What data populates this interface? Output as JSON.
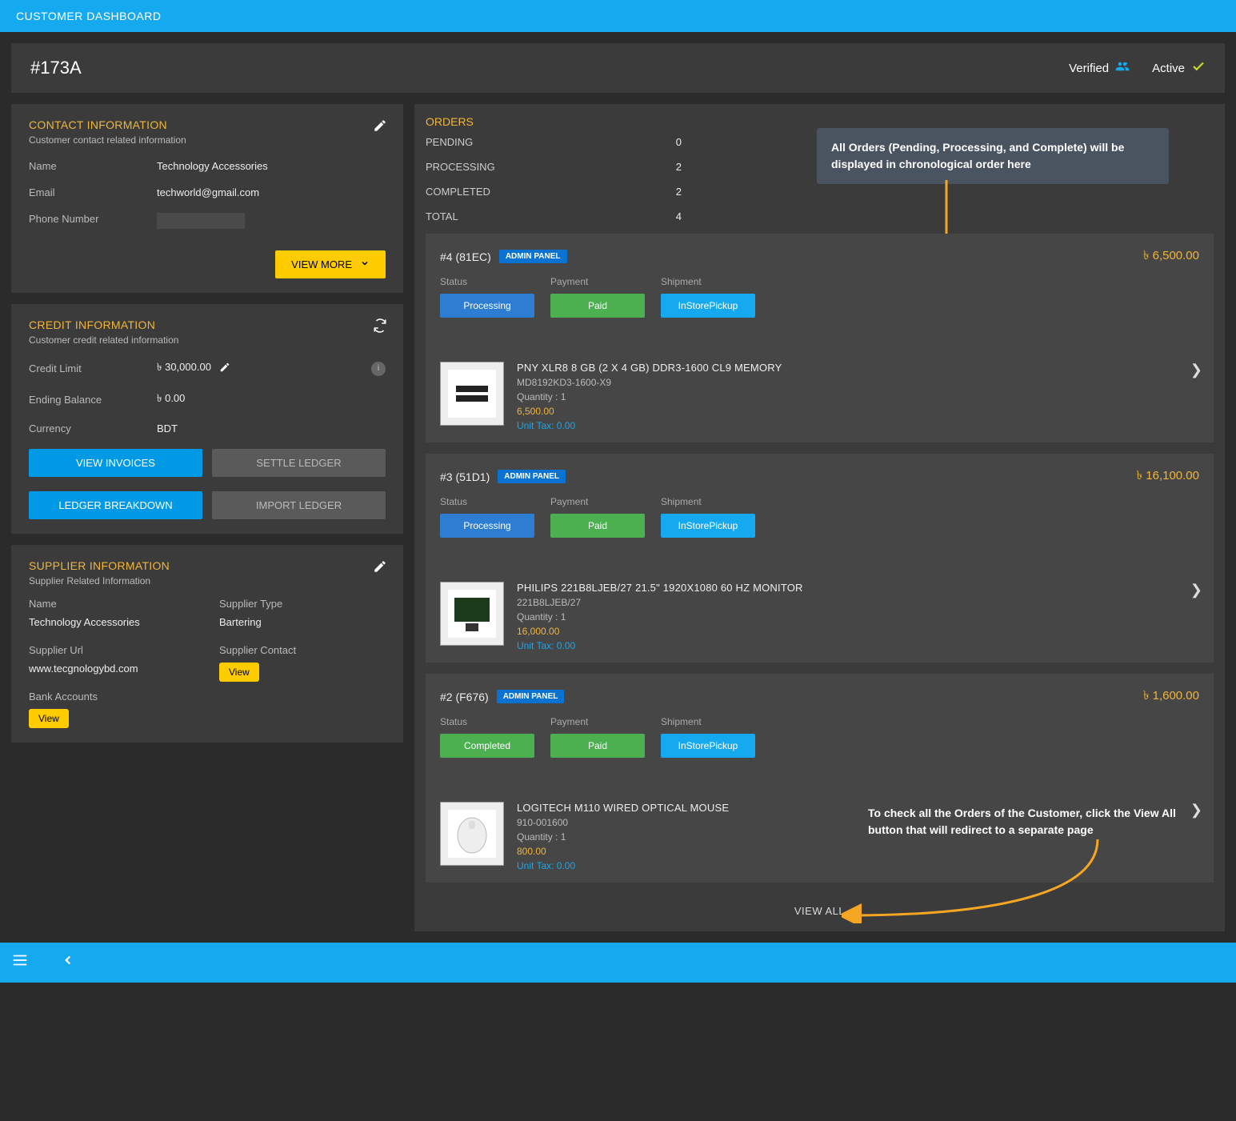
{
  "topbar": {
    "title": "CUSTOMER DASHBOARD"
  },
  "header": {
    "id": "#173A",
    "verified": "Verified",
    "active": "Active"
  },
  "contact": {
    "title": "CONTACT INFORMATION",
    "sub": "Customer contact related information",
    "name_label": "Name",
    "name": "Technology Accessories",
    "email_label": "Email",
    "email": "techworld@gmail.com",
    "phone_label": "Phone Number",
    "view_more": "VIEW MORE"
  },
  "credit": {
    "title": "CREDIT INFORMATION",
    "sub": "Customer credit related information",
    "limit_label": "Credit Limit",
    "limit": "৳  30,000.00",
    "balance_label": "Ending Balance",
    "balance": "৳ 0.00",
    "currency_label": "Currency",
    "currency": "BDT",
    "view_invoices": "VIEW INVOICES",
    "settle_ledger": "SETTLE LEDGER",
    "ledger_breakdown": "LEDGER BREAKDOWN",
    "import_ledger": "IMPORT LEDGER"
  },
  "supplier": {
    "title": "SUPPLIER INFORMATION",
    "sub": "Supplier Related Information",
    "name_label": "Name",
    "name": "Technology Accessories",
    "type_label": "Supplier Type",
    "type": "Bartering",
    "url_label": "Supplier Url",
    "url": "www.tecgnologybd.com",
    "contact_label": "Supplier Contact",
    "contact_view": "View",
    "bank_label": "Bank Accounts",
    "bank_view": "View"
  },
  "orders": {
    "title": "ORDERS",
    "summary": [
      {
        "label": "PENDING",
        "value": "0"
      },
      {
        "label": "PROCESSING",
        "value": "2"
      },
      {
        "label": "COMPLETED",
        "value": "2"
      },
      {
        "label": "TOTAL",
        "value": "4"
      }
    ],
    "callout1": "All Orders (Pending, Processing, and Complete) will be displayed in chronological order here",
    "callout2": "To check all the Orders of the Customer, click the View All button that will redirect to a separate page",
    "view_all": "VIEW ALL",
    "items": [
      {
        "id": "#4 (81EC)",
        "badge": "ADMIN PANEL",
        "price": "৳  6,500.00",
        "status_label": "Status",
        "status": "Processing",
        "status_color": "blue",
        "payment_label": "Payment",
        "payment": "Paid",
        "shipment_label": "Shipment",
        "shipment": "InStorePickup",
        "product": {
          "name": "PNY XLR8 8 GB (2 X 4 GB) DDR3-1600 CL9 MEMORY",
          "sku": "MD8192KD3-1600-X9",
          "qty": "Quantity : 1",
          "price": "6,500.00",
          "tax": "Unit Tax: 0.00"
        }
      },
      {
        "id": "#3 (51D1)",
        "badge": "ADMIN PANEL",
        "price": "৳  16,100.00",
        "status_label": "Status",
        "status": "Processing",
        "status_color": "blue",
        "payment_label": "Payment",
        "payment": "Paid",
        "shipment_label": "Shipment",
        "shipment": "InStorePickup",
        "product": {
          "name": "PHILIPS 221B8LJEB/27 21.5\" 1920X1080 60 HZ MONITOR",
          "sku": "221B8LJEB/27",
          "qty": "Quantity : 1",
          "price": "16,000.00",
          "tax": "Unit Tax: 0.00"
        }
      },
      {
        "id": "#2 (F676)",
        "badge": "ADMIN PANEL",
        "price": "৳  1,600.00",
        "status_label": "Status",
        "status": "Completed",
        "status_color": "green",
        "payment_label": "Payment",
        "payment": "Paid",
        "shipment_label": "Shipment",
        "shipment": "InStorePickup",
        "product": {
          "name": "LOGITECH M110 WIRED OPTICAL MOUSE",
          "sku": "910-001600",
          "qty": "Quantity : 1",
          "price": "800.00",
          "tax": "Unit Tax: 0.00"
        }
      }
    ]
  }
}
